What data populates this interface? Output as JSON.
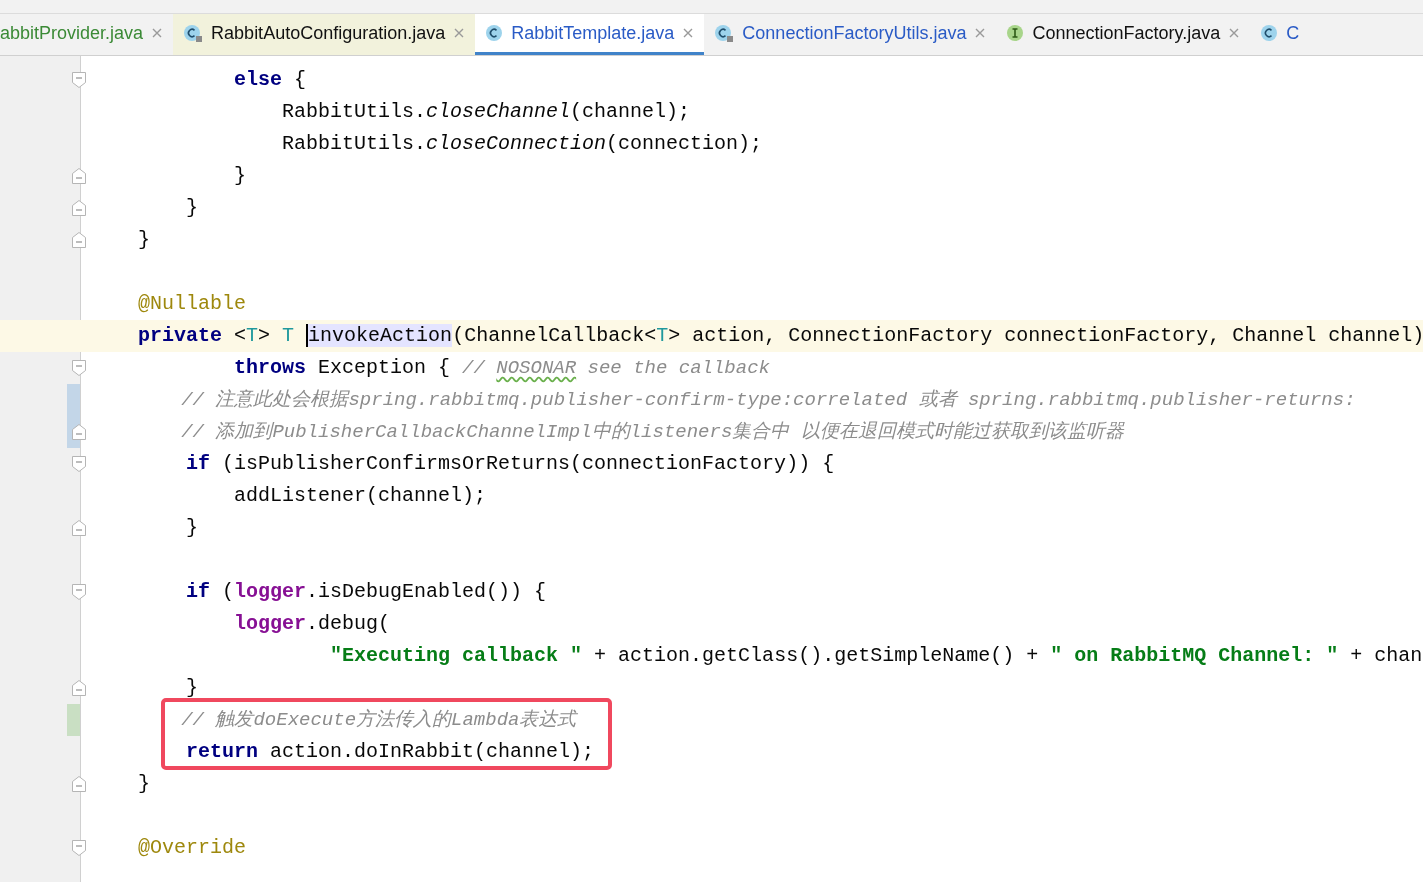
{
  "tabs": [
    {
      "label": "abbitProvider.java",
      "color": "#3b8a36",
      "library": false,
      "selected": false,
      "closable": true
    },
    {
      "label": "RabbitAutoConfiguration.java",
      "kind": "class-library",
      "color": "#111111",
      "library": true,
      "selected": false,
      "closable": true
    },
    {
      "label": "RabbitTemplate.java",
      "kind": "class",
      "color": "#2a5bc6",
      "library": false,
      "selected": true,
      "closable": true
    },
    {
      "label": "ConnectionFactoryUtils.java",
      "kind": "class-library",
      "color": "#2a5bc6",
      "library": false,
      "selected": false,
      "closable": true
    },
    {
      "label": "ConnectionFactory.java",
      "kind": "interface",
      "color": "#111111",
      "library": false,
      "selected": false,
      "closable": true
    },
    {
      "label": "C",
      "kind": "class",
      "color": "#2a5bc6",
      "library": false,
      "selected": false,
      "closable": false
    }
  ],
  "editor": {
    "lines": [
      {
        "kind": "code",
        "fold_start": true,
        "tokens": [
          {
            "kind": "keyword",
            "text": "            else"
          },
          {
            "kind": "plain",
            "text": " {"
          }
        ]
      },
      {
        "kind": "code",
        "tokens": [
          {
            "kind": "plain",
            "text": "                RabbitUtils."
          },
          {
            "kind": "static",
            "text": "closeChannel"
          },
          {
            "kind": "plain",
            "text": "(channel);"
          }
        ]
      },
      {
        "kind": "code",
        "tokens": [
          {
            "kind": "plain",
            "text": "                RabbitUtils."
          },
          {
            "kind": "static",
            "text": "closeConnection"
          },
          {
            "kind": "plain",
            "text": "(connection);"
          }
        ]
      },
      {
        "kind": "code",
        "fold_end": true,
        "tokens": [
          {
            "kind": "plain",
            "text": "            }"
          }
        ]
      },
      {
        "kind": "code",
        "fold_end": true,
        "tokens": [
          {
            "kind": "plain",
            "text": "        }"
          }
        ]
      },
      {
        "kind": "code",
        "fold_end": true,
        "tokens": [
          {
            "kind": "plain",
            "text": "    }"
          }
        ]
      },
      {
        "kind": "blank"
      },
      {
        "kind": "code",
        "tokens": [
          {
            "kind": "annotation",
            "text": "    @Nullable"
          }
        ]
      },
      {
        "kind": "code",
        "current": true,
        "tokens": [
          {
            "kind": "keyword",
            "text": "    private"
          },
          {
            "kind": "plain",
            "text": " <"
          },
          {
            "kind": "typeparam",
            "text": "T"
          },
          {
            "kind": "plain",
            "text": "> "
          },
          {
            "kind": "typeparam",
            "text": "T "
          },
          {
            "kind": "usage",
            "text": "invokeAction"
          },
          {
            "kind": "plain",
            "text": "(ChannelCallback<"
          },
          {
            "kind": "typeparam",
            "text": "T"
          },
          {
            "kind": "plain",
            "text": "> action, ConnectionFactory connectionFactory, Channel channel)"
          }
        ]
      },
      {
        "kind": "code",
        "fold_start": true,
        "tokens": [
          {
            "kind": "keyword",
            "text": "            throws"
          },
          {
            "kind": "plain",
            "text": " Exception { "
          },
          {
            "kind": "comment",
            "text": "// "
          },
          {
            "kind": "typo",
            "text": "NOSONAR"
          },
          {
            "kind": "comment",
            "text": " see the callback"
          }
        ]
      },
      {
        "kind": "code",
        "change": {
          "color": "#c3d6e8"
        },
        "tokens": [
          {
            "kind": "comment",
            "text": "        // 注意此处会根据spring.rabbitmq.publisher-confirm-type:correlated 或者 spring.rabbitmq.publisher-returns:"
          }
        ]
      },
      {
        "kind": "code",
        "change": {
          "color": "#c3d6e8"
        },
        "fold_end": true,
        "tokens": [
          {
            "kind": "comment",
            "text": "        // 添加到PublisherCallbackChannelImpl中的listeners集合中 以便在退回模式时能过获取到该监听器"
          }
        ]
      },
      {
        "kind": "code",
        "fold_start": true,
        "tokens": [
          {
            "kind": "keyword",
            "text": "        if"
          },
          {
            "kind": "plain",
            "text": " (isPublisherConfirmsOrReturns(connectionFactory)) {"
          }
        ]
      },
      {
        "kind": "code",
        "tokens": [
          {
            "kind": "plain",
            "text": "            addListener(channel);"
          }
        ]
      },
      {
        "kind": "code",
        "fold_end": true,
        "tokens": [
          {
            "kind": "plain",
            "text": "        }"
          }
        ]
      },
      {
        "kind": "blank"
      },
      {
        "kind": "code",
        "fold_start": true,
        "tokens": [
          {
            "kind": "keyword",
            "text": "        if"
          },
          {
            "kind": "plain",
            "text": " ("
          },
          {
            "kind": "field",
            "text": "logger"
          },
          {
            "kind": "plain",
            "text": ".isDebugEnabled()) {"
          }
        ]
      },
      {
        "kind": "code",
        "tokens": [
          {
            "kind": "field",
            "text": "            logger"
          },
          {
            "kind": "plain",
            "text": ".debug("
          }
        ]
      },
      {
        "kind": "code",
        "tokens": [
          {
            "kind": "string",
            "text": "                    \"Executing callback \""
          },
          {
            "kind": "plain",
            "text": " + action.getClass().getSimpleName() + "
          },
          {
            "kind": "string",
            "text": "\" on RabbitMQ Channel: \""
          },
          {
            "kind": "plain",
            "text": " + chan"
          }
        ]
      },
      {
        "kind": "code",
        "fold_end": true,
        "tokens": [
          {
            "kind": "plain",
            "text": "        }"
          }
        ]
      },
      {
        "kind": "code",
        "change": {
          "color": "#c9dfc3"
        },
        "boxed": true,
        "tokens": [
          {
            "kind": "comment",
            "text": "        // 触发doExecute方法传入的Lambda表达式"
          }
        ]
      },
      {
        "kind": "code",
        "boxed": true,
        "tokens": [
          {
            "kind": "keyword",
            "text": "        return"
          },
          {
            "kind": "plain",
            "text": " action.doInRabbit(channel);"
          }
        ]
      },
      {
        "kind": "code",
        "fold_end": true,
        "tokens": [
          {
            "kind": "plain",
            "text": "    }"
          }
        ]
      },
      {
        "kind": "blank"
      },
      {
        "kind": "code",
        "fold_start": true,
        "tokens": [
          {
            "kind": "annotation",
            "text": "    @Override"
          }
        ]
      }
    ]
  }
}
